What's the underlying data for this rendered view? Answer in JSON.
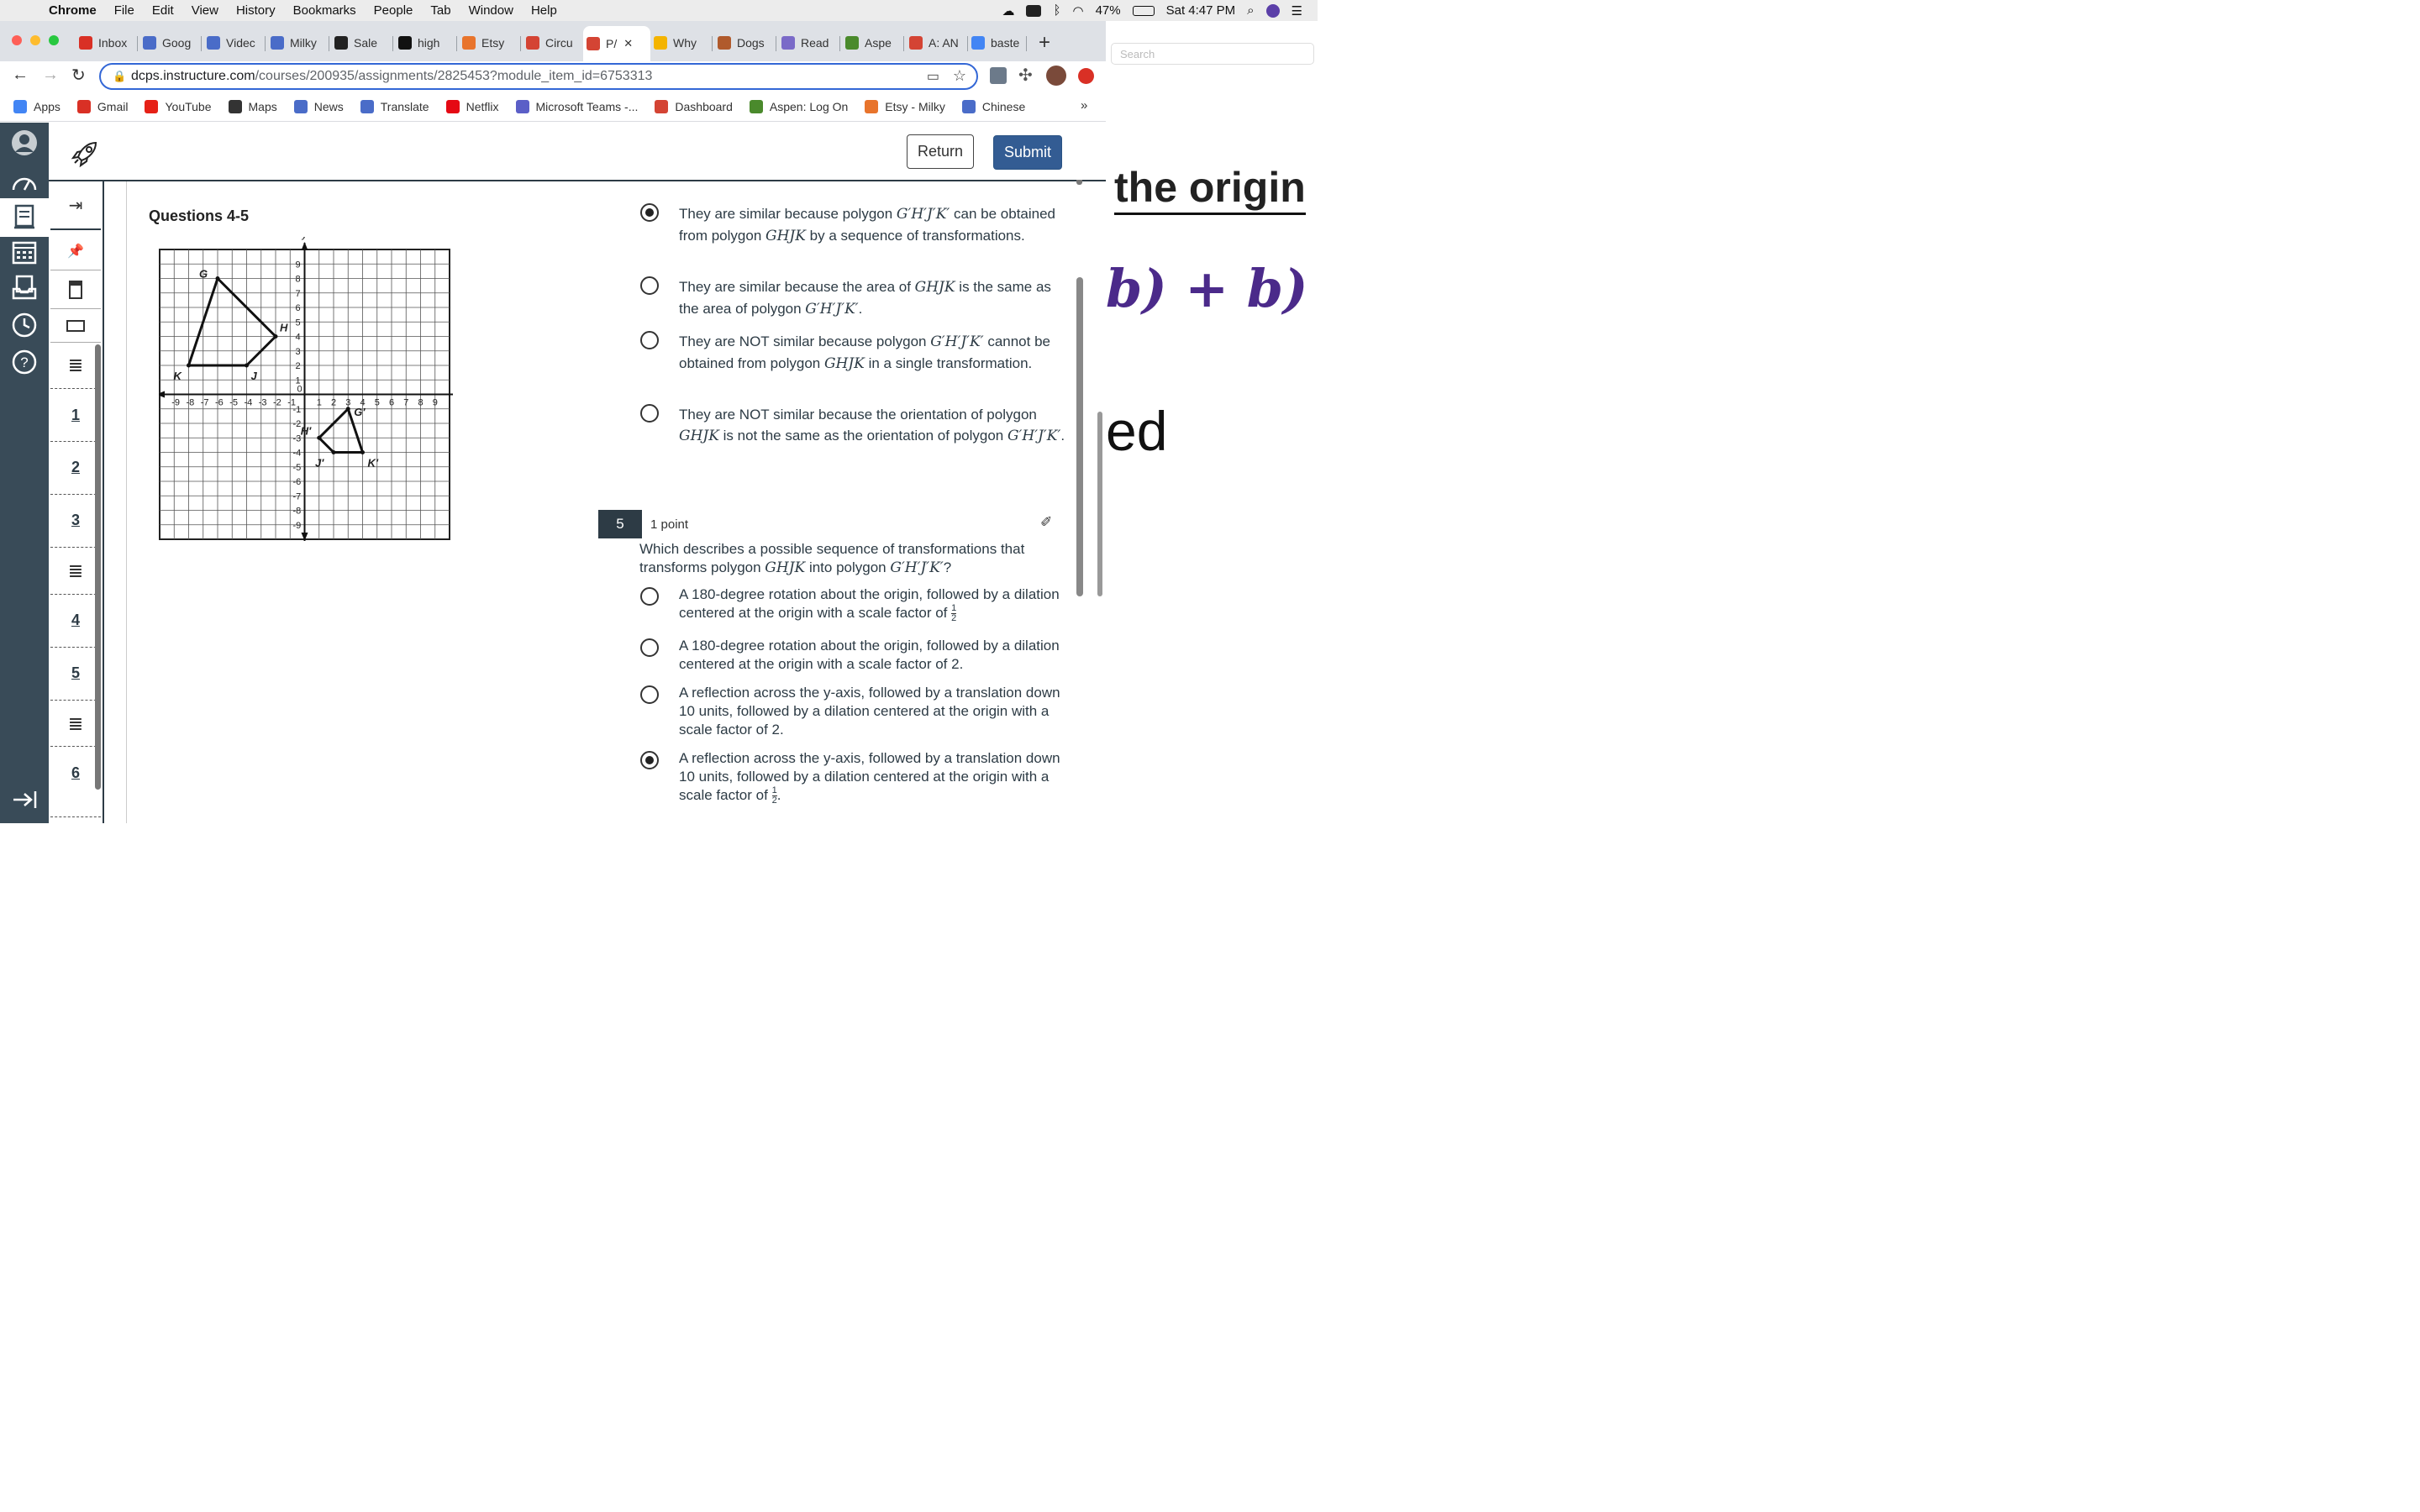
{
  "menubar": {
    "items": [
      "Chrome",
      "File",
      "Edit",
      "View",
      "History",
      "Bookmarks",
      "People",
      "Tab",
      "Window",
      "Help"
    ],
    "battery": "47%",
    "clock": "Sat 4:47 PM"
  },
  "tabs": [
    {
      "label": "Inbox",
      "icon": "gmail-icon",
      "color": "#d93025"
    },
    {
      "label": "Goog",
      "icon": "google-sites-icon",
      "color": "#4a6cc8"
    },
    {
      "label": "Videc",
      "icon": "google-docs-icon",
      "color": "#4a6cc8"
    },
    {
      "label": "Milky",
      "icon": "google-docs-icon",
      "color": "#4a6cc8"
    },
    {
      "label": "Sale",
      "icon": "uo-icon",
      "color": "#222"
    },
    {
      "label": "high",
      "icon": "dsw-icon",
      "color": "#111"
    },
    {
      "label": "Etsy",
      "icon": "etsy-icon",
      "color": "#e8742c"
    },
    {
      "label": "Circu",
      "icon": "canvas-icon",
      "color": "#d44434"
    },
    {
      "label": "P/",
      "icon": "canvas-icon",
      "color": "#d44434"
    },
    {
      "label": "Why",
      "icon": "slides-icon",
      "color": "#f4b400"
    },
    {
      "label": "Dogs",
      "icon": "paw-icon",
      "color": "#b05a2c"
    },
    {
      "label": "Read",
      "icon": "read-icon",
      "color": "#7a6ac8"
    },
    {
      "label": "Aspe",
      "icon": "aspen-icon",
      "color": "#4a8a2c"
    },
    {
      "label": "A: AN",
      "icon": "canvas-icon",
      "color": "#d44434"
    },
    {
      "label": "baste",
      "icon": "google-icon",
      "color": "#4285f4"
    }
  ],
  "address": {
    "host": "dcps.instructure.com",
    "path": "/courses/200935/assignments/2825453?module_item_id=6753313"
  },
  "bookmarks": [
    {
      "label": "Apps",
      "icon": "apps-grid-icon",
      "color": "#4285f4"
    },
    {
      "label": "Gmail",
      "icon": "gmail-icon",
      "color": "#d93025"
    },
    {
      "label": "YouTube",
      "icon": "youtube-icon",
      "color": "#e62117"
    },
    {
      "label": "Maps",
      "icon": "globe-icon",
      "color": "#333"
    },
    {
      "label": "News",
      "icon": "google-news-icon",
      "color": "#4a6cc8"
    },
    {
      "label": "Translate",
      "icon": "google-translate-icon",
      "color": "#4a6cc8"
    },
    {
      "label": "Netflix",
      "icon": "netflix-icon",
      "color": "#e50914"
    },
    {
      "label": "Microsoft Teams -...",
      "icon": "teams-icon",
      "color": "#5b5fc7"
    },
    {
      "label": "Dashboard",
      "icon": "canvas-icon",
      "color": "#d44434"
    },
    {
      "label": "Aspen: Log On",
      "icon": "aspen-icon",
      "color": "#4a8a2c"
    },
    {
      "label": "Etsy - Milky",
      "icon": "etsy-icon",
      "color": "#e8742c"
    },
    {
      "label": "Chinese",
      "icon": "google-translate-icon",
      "color": "#4a6cc8"
    }
  ],
  "bookmarks_more": "»",
  "bg_window": {
    "search_placeholder": "Search",
    "text1": "the origin",
    "text2": "b) + b)",
    "text3": "ed"
  },
  "header": {
    "return_label": "Return",
    "submit_label": "Submit"
  },
  "qnav": {
    "numbers": [
      "1",
      "2",
      "3",
      "4",
      "5",
      "6"
    ]
  },
  "section_title": "Questions 4-5",
  "q4": {
    "options": [
      {
        "pre": "They are similar because polygon ",
        "m1": "G′H′J′K′",
        "mid": " can be obtained from polygon ",
        "m2": "GHJK",
        "post": " by a sequence of transformations.",
        "checked": true
      },
      {
        "pre": "They are similar because the area of ",
        "m1": "GHJK",
        "mid": " is the same as the area of polygon ",
        "m2": "G′H′J′K′",
        "post": ".",
        "checked": false
      },
      {
        "pre": "They are NOT similar because polygon ",
        "m1": "G′H′J′K′",
        "mid": " cannot be obtained from polygon ",
        "m2": "GHJK",
        "post": " in a single transformation.",
        "checked": false
      },
      {
        "pre": "They are NOT similar because the orientation of polygon ",
        "m1": "GHJK",
        "mid": " is not the same as the orientation of polygon ",
        "m2": "G′H′J′K′",
        "post": ".",
        "checked": false
      }
    ]
  },
  "q5": {
    "number": "5",
    "points": "1 point",
    "prompt_pre": "Which describes a possible sequence of transformations that transforms polygon ",
    "prompt_m1": "GHJK",
    "prompt_mid": " into polygon ",
    "prompt_m2": "G′H′J′K′",
    "prompt_post": "?",
    "options": [
      {
        "text": "A 180-degree rotation about the origin, followed by a dilation centered at the origin with a scale factor of ",
        "frac_num": "1",
        "frac_den": "2",
        "post": "",
        "checked": false
      },
      {
        "text": "A 180-degree rotation about the origin, followed by a dilation centered at the origin with a scale factor of 2.",
        "checked": false
      },
      {
        "text": "A reflection across the y-axis, followed by a translation down 10 units, followed by a dilation centered at the origin with a scale factor of 2.",
        "checked": false
      },
      {
        "text": "A reflection across the y-axis, followed by a translation down 10 units, followed by a dilation centered at the origin with a scale factor of ",
        "frac_num": "1",
        "frac_den": "2",
        "post": ".",
        "checked": true
      }
    ]
  },
  "graph": {
    "x_label": "x",
    "y_label": "y",
    "x_ticks": [
      "-9",
      "-8",
      "-7",
      "-6",
      "-5",
      "-4",
      "-3",
      "-2",
      "-1",
      "0",
      "1",
      "2",
      "3",
      "4",
      "5",
      "6",
      "7",
      "8",
      "9"
    ],
    "y_ticks_pos": [
      "9",
      "8",
      "7",
      "6",
      "5",
      "4",
      "3",
      "2",
      "1"
    ],
    "y_ticks_neg": [
      "-1",
      "-2",
      "-3",
      "-4",
      "-5",
      "-6",
      "-7",
      "-8",
      "-9"
    ],
    "polygon_GHJK": {
      "G": [
        -6,
        8
      ],
      "H": [
        -2,
        4
      ],
      "J": [
        -4,
        2
      ],
      "K": [
        -8,
        2
      ]
    },
    "polygon_G'H'J'K'": {
      "G'": [
        3,
        -1
      ],
      "H'": [
        1,
        -3
      ],
      "J'": [
        2,
        -4
      ],
      "K'": [
        4,
        -4
      ]
    },
    "labels": {
      "G": "G",
      "H": "H",
      "J": "J",
      "K": "K",
      "G2": "G′",
      "H2": "H′",
      "J2": "J′",
      "K2": "K′"
    }
  }
}
